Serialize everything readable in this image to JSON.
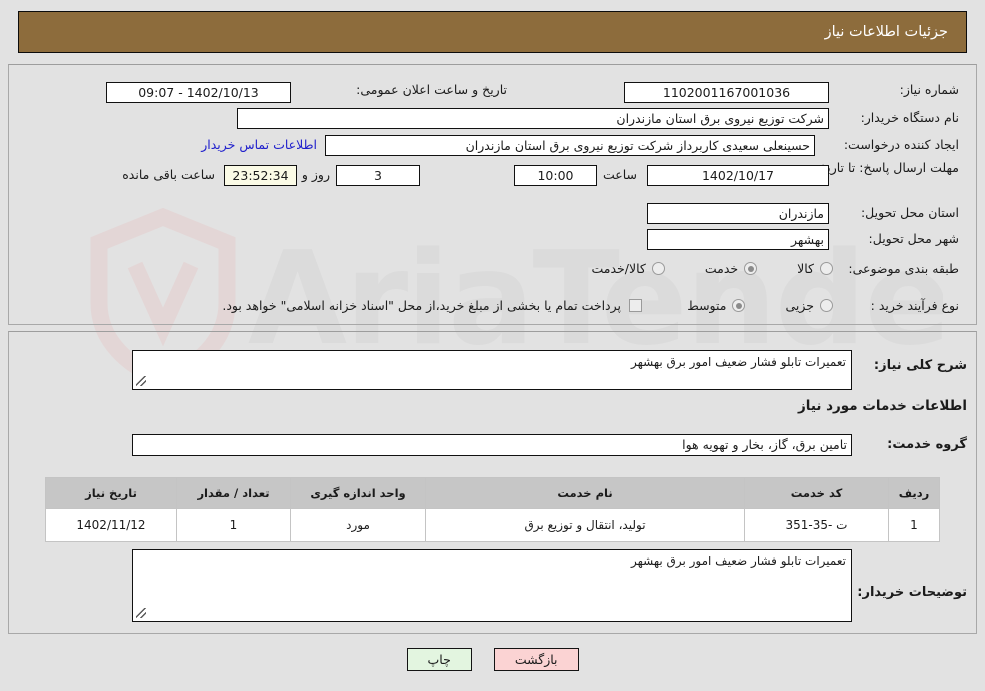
{
  "header": {
    "title": "جزئیات اطلاعات نیاز"
  },
  "watermark": {
    "text": "AriaTender.net"
  },
  "colors": {
    "header_bg": "#8d6c3c",
    "page_bg": "#e2e2e2",
    "link": "#2020cc",
    "table_header_bg": "#c6c6c6",
    "print_button_bg": "#e3f5e0",
    "back_button_bg": "#fbd3d3",
    "countdown_bg": "#fbfbe6"
  },
  "top_panel": {
    "need_number": {
      "label": "شماره نیاز:",
      "value": "1102001167001036"
    },
    "buyer_org": {
      "label": "نام دستگاه خریدار:",
      "value": "شرکت توزیع نیروی برق استان مازندران"
    },
    "request_creator": {
      "label": "ایجاد کننده درخواست:",
      "value": "حسینعلی سعیدی کاربرداز شرکت توزیع نیروی برق استان مازندران"
    },
    "public_announce": {
      "label": "تاریخ و ساعت اعلان عمومی:",
      "value": "1402/10/13 - 09:07"
    },
    "contact_link": "اطلاعات تماس خریدار",
    "deadline": {
      "label": "مهلت ارسال پاسخ: تا تاریخ:",
      "date": "1402/10/17",
      "time_label": "ساعت",
      "time": "10:00",
      "days": "3",
      "days_label": "روز و",
      "countdown": "23:52:34",
      "countdown_label": "ساعت باقی مانده"
    },
    "delivery_province": {
      "label": "استان محل تحویل:",
      "value": "مازندران"
    },
    "delivery_city": {
      "label": "شهر محل تحویل:",
      "value": "بهشهر"
    },
    "category": {
      "label": "طبقه بندی موضوعی:",
      "options": [
        {
          "label": "کالا",
          "selected": false
        },
        {
          "label": "خدمت",
          "selected": true
        },
        {
          "label": "کالا/خدمت",
          "selected": false
        }
      ]
    },
    "purchase_type": {
      "label": "نوع فرآیند خرید :",
      "options": [
        {
          "label": "جزیی",
          "selected": false
        },
        {
          "label": "متوسط",
          "selected": true
        }
      ],
      "checkbox": {
        "checked": false,
        "text": "پرداخت تمام یا بخشی از مبلغ خرید،از محل \"اسناد خزانه اسلامی\" خواهد بود."
      }
    }
  },
  "bottom_panel": {
    "general_desc": {
      "label": "شرح کلی نیاز:",
      "value": "تعمیرات تابلو فشار ضعیف امور برق بهشهر"
    },
    "section_title": "اطلاعات خدمات مورد نیاز",
    "service_group": {
      "label": "گروه خدمت:",
      "value": "تامین برق، گاز، بخار و تهویه هوا"
    },
    "table": {
      "columns": [
        "ردیف",
        "کد خدمت",
        "نام خدمت",
        "واحد اندازه گیری",
        "تعداد / مقدار",
        "تاریخ نیاز"
      ],
      "rows": [
        [
          "1",
          "ت -35-351",
          "تولید، انتقال و توزیع برق",
          "مورد",
          "1",
          "1402/11/12"
        ]
      ]
    },
    "buyer_notes": {
      "label": "توضیحات خریدار:",
      "value": "تعمیرات تابلو فشار ضعیف امور برق بهشهر"
    }
  },
  "footer": {
    "print_label": "چاپ",
    "back_label": "بازگشت"
  }
}
